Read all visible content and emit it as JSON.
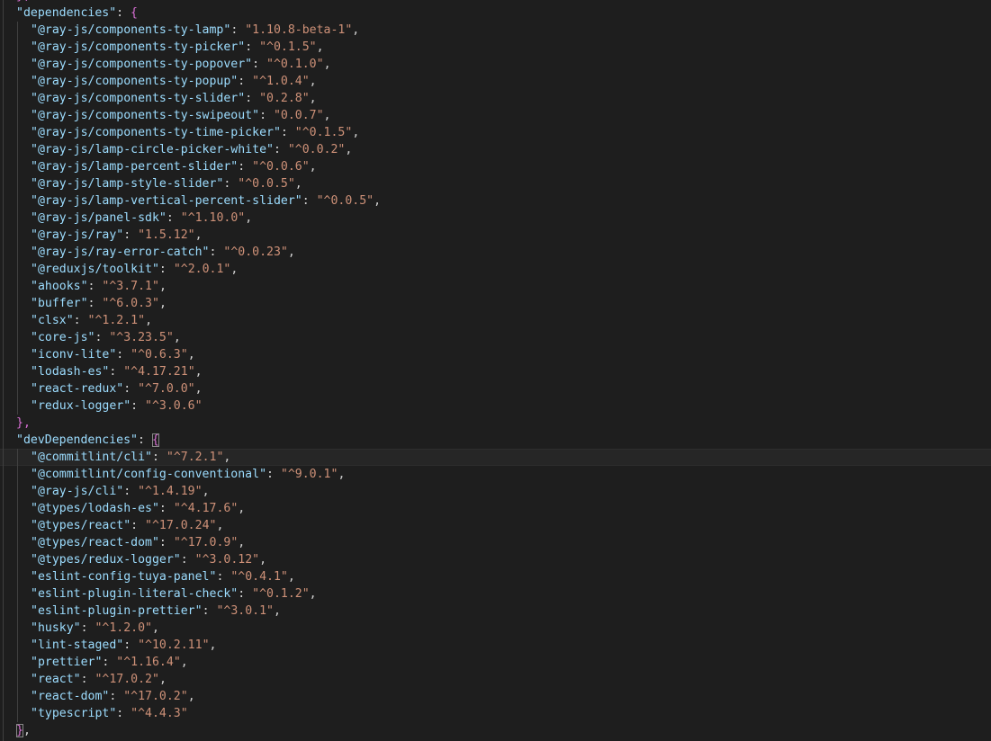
{
  "editor": {
    "theme": {
      "background": "#1e1e1e",
      "key_color": "#9cdcfe",
      "string_color": "#ce9178",
      "bracket_color": "#da70d6",
      "punctuation_color": "#d4d4d4"
    },
    "top_partial": "},",
    "dependencies": {
      "key": "\"dependencies\"",
      "open": "{",
      "close": "},",
      "entries": [
        {
          "k": "\"@ray-js/components-ty-lamp\"",
          "v": "\"1.10.8-beta-1\""
        },
        {
          "k": "\"@ray-js/components-ty-picker\"",
          "v": "\"^0.1.5\""
        },
        {
          "k": "\"@ray-js/components-ty-popover\"",
          "v": "\"^0.1.0\""
        },
        {
          "k": "\"@ray-js/components-ty-popup\"",
          "v": "\"^1.0.4\""
        },
        {
          "k": "\"@ray-js/components-ty-slider\"",
          "v": "\"0.2.8\""
        },
        {
          "k": "\"@ray-js/components-ty-swipeout\"",
          "v": "\"0.0.7\""
        },
        {
          "k": "\"@ray-js/components-ty-time-picker\"",
          "v": "\"^0.1.5\""
        },
        {
          "k": "\"@ray-js/lamp-circle-picker-white\"",
          "v": "\"^0.0.2\""
        },
        {
          "k": "\"@ray-js/lamp-percent-slider\"",
          "v": "\"^0.0.6\""
        },
        {
          "k": "\"@ray-js/lamp-style-slider\"",
          "v": "\"^0.0.5\""
        },
        {
          "k": "\"@ray-js/lamp-vertical-percent-slider\"",
          "v": "\"^0.0.5\""
        },
        {
          "k": "\"@ray-js/panel-sdk\"",
          "v": "\"^1.10.0\""
        },
        {
          "k": "\"@ray-js/ray\"",
          "v": "\"1.5.12\""
        },
        {
          "k": "\"@ray-js/ray-error-catch\"",
          "v": "\"^0.0.23\""
        },
        {
          "k": "\"@reduxjs/toolkit\"",
          "v": "\"^2.0.1\""
        },
        {
          "k": "\"ahooks\"",
          "v": "\"^3.7.1\""
        },
        {
          "k": "\"buffer\"",
          "v": "\"^6.0.3\""
        },
        {
          "k": "\"clsx\"",
          "v": "\"^1.2.1\""
        },
        {
          "k": "\"core-js\"",
          "v": "\"^3.23.5\""
        },
        {
          "k": "\"iconv-lite\"",
          "v": "\"^0.6.3\""
        },
        {
          "k": "\"lodash-es\"",
          "v": "\"^4.17.21\""
        },
        {
          "k": "\"react-redux\"",
          "v": "\"^7.0.0\""
        },
        {
          "k": "\"redux-logger\"",
          "v": "\"^3.0.6\""
        }
      ]
    },
    "devDependencies": {
      "key": "\"devDependencies\"",
      "open": "{",
      "close": "},",
      "entries": [
        {
          "k": "\"@commitlint/cli\"",
          "v": "\"^7.2.1\""
        },
        {
          "k": "\"@commitlint/config-conventional\"",
          "v": "\"^9.0.1\""
        },
        {
          "k": "\"@ray-js/cli\"",
          "v": "\"^1.4.19\""
        },
        {
          "k": "\"@types/lodash-es\"",
          "v": "\"^4.17.6\""
        },
        {
          "k": "\"@types/react\"",
          "v": "\"^17.0.24\""
        },
        {
          "k": "\"@types/react-dom\"",
          "v": "\"^17.0.9\""
        },
        {
          "k": "\"@types/redux-logger\"",
          "v": "\"^3.0.12\""
        },
        {
          "k": "\"eslint-config-tuya-panel\"",
          "v": "\"^0.4.1\""
        },
        {
          "k": "\"eslint-plugin-literal-check\"",
          "v": "\"^0.1.2\""
        },
        {
          "k": "\"eslint-plugin-prettier\"",
          "v": "\"^3.0.1\""
        },
        {
          "k": "\"husky\"",
          "v": "\"^1.2.0\""
        },
        {
          "k": "\"lint-staged\"",
          "v": "\"^10.2.11\""
        },
        {
          "k": "\"prettier\"",
          "v": "\"^1.16.4\""
        },
        {
          "k": "\"react\"",
          "v": "\"^17.0.2\""
        },
        {
          "k": "\"react-dom\"",
          "v": "\"^17.0.2\""
        },
        {
          "k": "\"typescript\"",
          "v": "\"^4.4.3\""
        }
      ]
    }
  }
}
